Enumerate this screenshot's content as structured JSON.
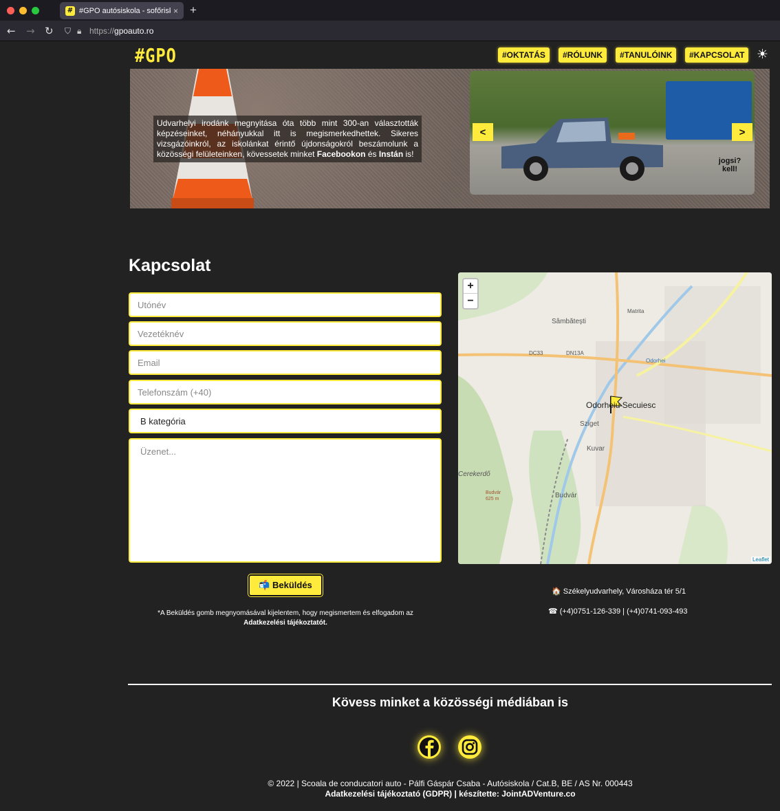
{
  "browser": {
    "tab_title": "#GPO autósiskola - sofőriskola",
    "tab_favicon": "#",
    "tab_close": "×",
    "new_tab": "+",
    "url_scheme": "https://",
    "url_host": "gpoauto.ro",
    "back": "←",
    "forward": "→",
    "reload": "↻"
  },
  "header": {
    "logo": "#GPO",
    "menu": [
      "#OKTATÁS",
      "#RÓLUNK",
      "#TANULÓINK",
      "#KAPCSOLAT"
    ],
    "theme_toggle": "☀"
  },
  "hero": {
    "text_1": "Udvarhelyi irodánk megnyitása óta több mint 300-an választották képzéseinket, néhányukkal itt is megismerkedhettek. Sikeres vizsgázóinkról, az iskolánkat érintő újdonságokról beszámolunk a közösségi felületeinken, kövessetek minket ",
    "facebook": "Facebookon",
    "and": " és ",
    "insta": "Instán",
    "text_end": " is!",
    "prev": "<",
    "next": ">",
    "trailer_text": "jogsi? kell!"
  },
  "contact": {
    "title": "Kapcsolat",
    "first_name_placeholder": "Utónév",
    "last_name_placeholder": "Vezetéknév",
    "email_placeholder": "Email",
    "phone_placeholder": "Telefonszám (+40)",
    "category_value": "B kategória",
    "message_placeholder": "Üzenet...",
    "send_label": "📬 Beküldés",
    "disclaimer_1": "*A Beküldés gomb megnyomásával kijelentem, hogy megismertem és elfogadom az ",
    "disclaimer_link": "Adatkezelési tájékoztatót."
  },
  "map": {
    "zoom_in": "+",
    "zoom_out": "−",
    "credit": "Leaflet",
    "labels": [
      "Sâmbătești",
      "DC33",
      "DN13A",
      "Odorheiu Secuiesc",
      "Sziget",
      "Kuvar",
      "Budvár",
      "Cerekerdő",
      "Matrita",
      "Odorhei",
      "Budvár 625 m"
    ]
  },
  "address": {
    "location": "🏠 Székelyudvarhely, Városháza tér 5/1",
    "phone": "☎ (+4)0751-126-339 | (+4)0741-093-493"
  },
  "footer": {
    "follow": "Kövess minket a közösségi médiában is",
    "copyright": "© 2022 | Scoala de conducatori auto - Pálfi Gáspár Csaba - Autósiskola / Cat.B, BE / AS Nr. 000443",
    "credits": "Adatkezelési tájékoztató (GDPR) | készítette: JointADVenture.co"
  }
}
